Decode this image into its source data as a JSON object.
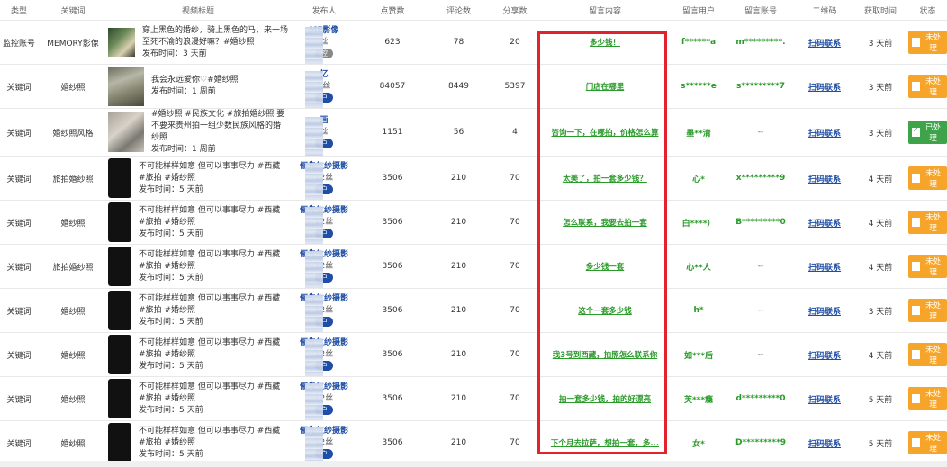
{
  "columns": [
    "类型",
    "关键词",
    "视频标题",
    "发布人",
    "点赞数",
    "评论数",
    "分享数",
    "留言内容",
    "留言用户",
    "留言账号",
    "二维码",
    "获取时间",
    "状态"
  ],
  "rows": [
    {
      "type": "监控账号",
      "keyword": "MEMORY影像",
      "thumb": "photo1",
      "title": "穿上黑色的婚纱，骑上黑色的马，来一场至死不渝的浪漫好嘛？#婚纱照",
      "time": "发布时间：3 天前",
      "pub_name": "ME影像",
      "pub_fans": "丝",
      "pub_badge": "控",
      "badge_style": "gray",
      "likes": "623",
      "comments": "78",
      "shares": "20",
      "comment_text": "多少钱！",
      "cuser": "f******a",
      "cacct": "m*********.",
      "qr": "扫码联系",
      "fetched": "3 天前",
      "status": "未处理",
      "status_style": "pending"
    },
    {
      "type": "关键词",
      "keyword": "婚纱照",
      "thumb": "photo2",
      "title": "我会永远爱你♡#婚纱照",
      "time": "发布时间：1 周前",
      "pub_name": "忆",
      "pub_fans": "1丝",
      "pub_badge": "户",
      "badge_style": "blue",
      "likes": "84057",
      "comments": "8449",
      "shares": "5397",
      "comment_text": "门店在哪里",
      "cuser": "s******e",
      "cacct": "s*********7",
      "qr": "扫码联系",
      "fetched": "3 天前",
      "status": "未处理",
      "status_style": "pending"
    },
    {
      "type": "关键词",
      "keyword": "婚纱照风格",
      "thumb": "photo3",
      "title": "#婚纱照 #民族文化 #旅拍婚纱照 要不要来贵州拍一组少数民族风格的婚纱照",
      "time": "发布时间：1 周前",
      "pub_name": "画",
      "pub_fans": "丝",
      "pub_badge": "户",
      "badge_style": "blue",
      "likes": "1151",
      "comments": "56",
      "shares": "4",
      "comment_text": "咨询一下，在哪拍，价格怎么算",
      "cuser": "墨**清",
      "cacct": "--",
      "qr": "扫码联系",
      "fetched": "3 天前",
      "status": "已处理",
      "status_style": "done"
    },
    {
      "type": "关键词",
      "keyword": "旅拍婚纱照",
      "thumb": "dark",
      "title": "不可能样样如意 但可以事事尽力 #西藏 #旅拍 #婚纱照",
      "time": "发布时间：5 天前",
      "pub_name": "俪先生纱摄影",
      "pub_fans": "12丝",
      "pub_badge": "户",
      "badge_style": "blue",
      "likes": "3506",
      "comments": "210",
      "shares": "70",
      "comment_text": "太美了，拍一套多少钱？",
      "cuser": "心*",
      "cacct": "x*********9",
      "qr": "扫码联系",
      "fetched": "4 天前",
      "status": "未处理",
      "status_style": "pending"
    },
    {
      "type": "关键词",
      "keyword": "婚纱照",
      "thumb": "dark",
      "title": "不可能样样如意 但可以事事尽力 #西藏 #旅拍 #婚纱照",
      "time": "发布时间：5 天前",
      "pub_name": "俪先生纱摄影",
      "pub_fans": "12丝",
      "pub_badge": "户",
      "badge_style": "blue",
      "likes": "3506",
      "comments": "210",
      "shares": "70",
      "comment_text": "怎么联系，我要去拍一套",
      "cuser": "白****）",
      "cacct": "B*********0",
      "qr": "扫码联系",
      "fetched": "4 天前",
      "status": "未处理",
      "status_style": "pending"
    },
    {
      "type": "关键词",
      "keyword": "旅拍婚纱照",
      "thumb": "dark",
      "title": "不可能样样如意 但可以事事尽力 #西藏 #旅拍 #婚纱照",
      "time": "发布时间：5 天前",
      "pub_name": "俪先生纱摄影",
      "pub_fans": "12丝",
      "pub_badge": "户",
      "badge_style": "blue",
      "likes": "3506",
      "comments": "210",
      "shares": "70",
      "comment_text": "多少钱一套",
      "cuser": "心**人",
      "cacct": "--",
      "qr": "扫码联系",
      "fetched": "4 天前",
      "status": "未处理",
      "status_style": "pending"
    },
    {
      "type": "关键词",
      "keyword": "婚纱照",
      "thumb": "dark",
      "title": "不可能样样如意 但可以事事尽力 #西藏 #旅拍 #婚纱照",
      "time": "发布时间：5 天前",
      "pub_name": "俪先生纱摄影",
      "pub_fans": "12丝",
      "pub_badge": "户",
      "badge_style": "blue",
      "likes": "3506",
      "comments": "210",
      "shares": "70",
      "comment_text": "这个一套多少钱",
      "cuser": "h*",
      "cacct": "--",
      "qr": "扫码联系",
      "fetched": "3 天前",
      "status": "未处理",
      "status_style": "pending"
    },
    {
      "type": "关键词",
      "keyword": "婚纱照",
      "thumb": "dark",
      "title": "不可能样样如意 但可以事事尽力 #西藏 #旅拍 #婚纱照",
      "time": "发布时间：5 天前",
      "pub_name": "俪先生纱摄影",
      "pub_fans": "12丝",
      "pub_badge": "户",
      "badge_style": "blue",
      "likes": "3506",
      "comments": "210",
      "shares": "70",
      "comment_text": "我3号到西藏，拍照怎么联系你",
      "cuser": "如***后",
      "cacct": "--",
      "qr": "扫码联系",
      "fetched": "4 天前",
      "status": "未处理",
      "status_style": "pending"
    },
    {
      "type": "关键词",
      "keyword": "婚纱照",
      "thumb": "dark",
      "title": "不可能样样如意 但可以事事尽力 #西藏 #旅拍 #婚纱照",
      "time": "发布时间：5 天前",
      "pub_name": "俪先生纱摄影",
      "pub_fans": "12丝",
      "pub_badge": "户",
      "badge_style": "blue",
      "likes": "3506",
      "comments": "210",
      "shares": "70",
      "comment_text": "拍一套多少钱，拍的好漂亮",
      "cuser": "芙***瘾",
      "cacct": "d*********0",
      "qr": "扫码联系",
      "fetched": "5 天前",
      "status": "未处理",
      "status_style": "pending"
    },
    {
      "type": "关键词",
      "keyword": "婚纱照",
      "thumb": "dark",
      "title": "不可能样样如意 但可以事事尽力 #西藏 #旅拍 #婚纱照",
      "time": "发布时间：5 天前",
      "pub_name": "俪先生纱摄影",
      "pub_fans": "12丝",
      "pub_badge": "户",
      "badge_style": "blue",
      "likes": "3506",
      "comments": "210",
      "shares": "70",
      "comment_text": "下个月去拉萨，想拍一套，多...",
      "cuser": "女*",
      "cacct": "D*********9",
      "qr": "扫码联系",
      "fetched": "5 天前",
      "status": "未处理",
      "status_style": "pending"
    }
  ],
  "colors": {
    "link_blue": "#1f4ea6",
    "comment_green": "#2a9a2a",
    "pending": "#f7a52a",
    "done": "#3fa34a",
    "highlight_red": "#e2222c"
  }
}
